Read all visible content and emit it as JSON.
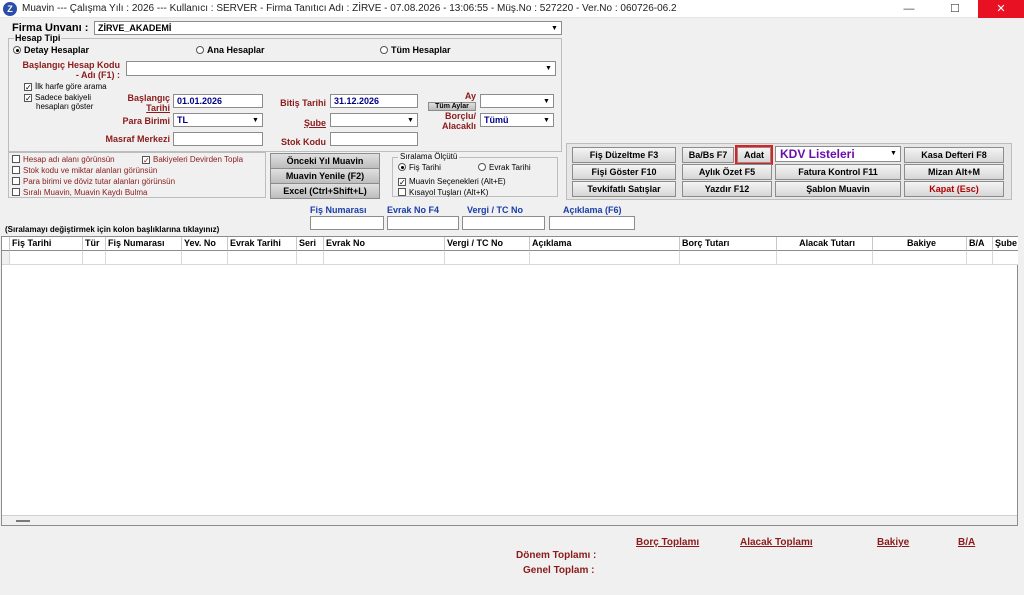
{
  "window": {
    "icon_letter": "Z",
    "title": "Muavin  ---  Çalışma Yılı : 2026  ---  Kullanıcı : SERVER - Firma Tanıtıcı Adı : ZİRVE - 07.08.2026 - 13:06:55 - Müş.No : 527220 - Ver.No : 060726-06.2",
    "min_glyph": "—",
    "max_glyph": "☐",
    "close_glyph": "✕"
  },
  "firma": {
    "label": "Firma Unvanı :",
    "value": "ZİRVE_AKADEMİ"
  },
  "hesap_tipi": {
    "label": "Hesap Tipi",
    "options": [
      {
        "label": "Detay Hesaplar",
        "selected": true
      },
      {
        "label": "Ana Hesaplar",
        "selected": false
      },
      {
        "label": "Tüm Hesaplar",
        "selected": false
      }
    ]
  },
  "filters": {
    "baslangic_hesap_label1": "Başlangıç Hesap Kodu",
    "baslangic_hesap_label2": "- Adı (F1) :",
    "baslangic_hesap_value": "",
    "ilk_harfe_gore": "İlk harfe göre arama",
    "sadece_bakiyeli1": "Sadece bakiyeli",
    "sadece_bakiyeli2": "hesapları göster",
    "baslangic_tarihi_label1": "Başlangıç",
    "baslangic_tarihi_label2": "Tarihi",
    "baslangic_tarihi_value": "01.01.2026",
    "bitis_tarihi_label": "Bitiş Tarihi",
    "bitis_tarihi_value": "31.12.2026",
    "ay_label": "Ay",
    "tum_aylar_button": "Tüm Aylar",
    "ay_value": "",
    "para_birimi_label": "Para Birimi",
    "para_birimi_value": "TL",
    "sube_label": "Şube",
    "sube_value": "",
    "borclu_label1": "Borçlu/",
    "borclu_label2": "Alacaklı",
    "borclu_value": "Tümü",
    "masraf_label": "Masraf Merkezi",
    "masraf_value": "",
    "stok_label": "Stok Kodu",
    "stok_value": ""
  },
  "options_checks": [
    {
      "label": "Hesap adı alanı görünsün",
      "checked": false
    },
    {
      "label": "Bakiyeleri Devirden Topla",
      "checked": true
    },
    {
      "label": "Stok kodu ve miktar alanları görünsün",
      "checked": false
    },
    {
      "label": "Para birimi ve döviz tutar alanları görünsün",
      "checked": false
    },
    {
      "label": "Sıralı Muavin, Muavin Kaydı Bulma",
      "checked": false
    }
  ],
  "middle_buttons": {
    "onceki_yil": "Önceki Yıl Muavin",
    "muavin_yenile": "Muavin Yenile (F2)",
    "excel": "Excel (Ctrl+Shift+L)"
  },
  "siralama": {
    "label": "Sıralama Ölçütü",
    "options": [
      {
        "label": "Fiş Tarihi",
        "selected": true
      },
      {
        "label": "Evrak Tarihi",
        "selected": false
      }
    ],
    "secenekler": "Muavin Seçenekleri (Alt+E)",
    "secenekler_checked": true,
    "kisayol": "Kısayol Tuşları (Alt+K)",
    "kisayol_checked": false
  },
  "action_buttons": {
    "fis_duzeltme": "Fiş Düzeltme F3",
    "babs": "Ba/Bs F7",
    "adat": "Adat",
    "kdv_listeleri": "KDV Listeleri",
    "kasa_defteri": "Kasa Defteri F8",
    "fisi_goster": "Fişi Göster F10",
    "aylik_ozet": "Aylık Özet F5",
    "fatura_kontrol": "Fatura Kontrol F11",
    "mizan": "Mizan Alt+M",
    "tevkifatli": "Tevkifatlı Satışlar",
    "yazdir": "Yazdır F12",
    "sablon_muavin": "Şablon Muavin",
    "kapat": "Kapat (Esc)"
  },
  "search_fields": {
    "fis_numarasi": "Fiş Numarası",
    "evrak_no": "Evrak No F4",
    "vergi_tc": "Vergi / TC No",
    "aciklama": "Açıklama (F6)"
  },
  "sort_hint": "(Sıralamayı değiştirmek için kolon başlıklarına tıklayınız)",
  "grid_columns": [
    "Fiş Tarihi",
    "Tür",
    "Fiş Numarası",
    "Yev. No",
    "Evrak Tarihi",
    "Seri",
    "Evrak No",
    "Vergi / TC No",
    "Açıklama",
    "Borç Tutarı",
    "Alacak Tutarı",
    "Bakiye",
    "B/A",
    "Şube"
  ],
  "totals": {
    "borc": "Borç Toplamı",
    "alacak": "Alacak Toplamı",
    "bakiye": "Bakiye",
    "ba": "B/A",
    "donem": "Dönem Toplamı :",
    "genel": "Genel Toplam :"
  }
}
